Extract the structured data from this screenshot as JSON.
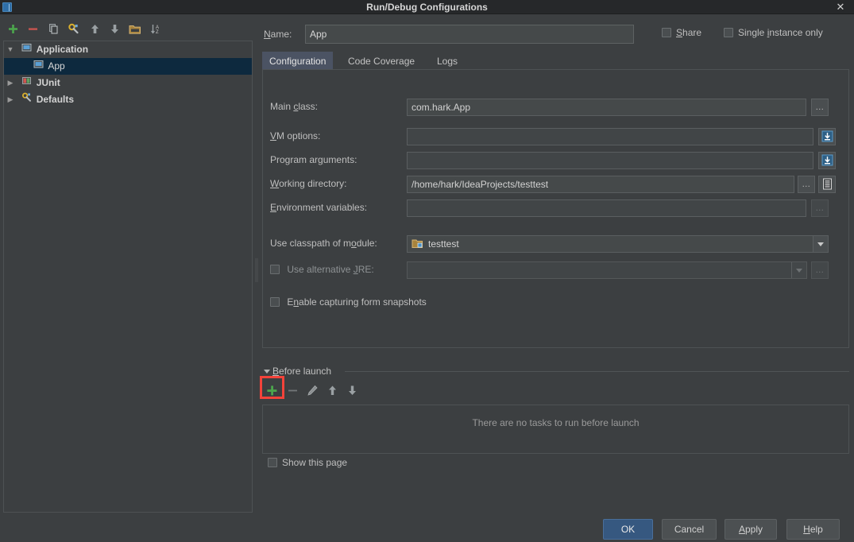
{
  "window": {
    "title": "Run/Debug Configurations",
    "close_label": "✕",
    "icon": "intellij-window-icon"
  },
  "sidebar": {
    "toolbar": [
      {
        "name": "add-configuration-button",
        "icon": "plus-icon",
        "tooltip": "Add New Configuration"
      },
      {
        "name": "remove-configuration-button",
        "icon": "minus-icon",
        "tooltip": "Remove Configuration"
      },
      {
        "name": "copy-configuration-button",
        "icon": "copy-icon",
        "tooltip": "Copy Configuration"
      },
      {
        "name": "edit-defaults-button",
        "icon": "wrench-icon",
        "tooltip": "Edit defaults"
      },
      {
        "name": "move-up-button",
        "icon": "arrow-up-icon",
        "tooltip": "Move Up"
      },
      {
        "name": "move-down-button",
        "icon": "arrow-down-icon",
        "tooltip": "Move Down"
      },
      {
        "name": "create-folder-button",
        "icon": "folder-icon",
        "tooltip": "Create New Folder"
      },
      {
        "name": "sort-configurations-button",
        "icon": "sort-az-icon",
        "tooltip": "Sort Configurations"
      }
    ],
    "tree": [
      {
        "label": "Application",
        "icon": "application-icon",
        "expanded": true,
        "selected": false,
        "level": 0,
        "twisty": "▼"
      },
      {
        "label": "App",
        "icon": "application-icon",
        "expanded": false,
        "selected": true,
        "level": 1,
        "twisty": ""
      },
      {
        "label": "JUnit",
        "icon": "junit-icon",
        "expanded": false,
        "selected": false,
        "level": 0,
        "twisty": "▶"
      },
      {
        "label": "Defaults",
        "icon": "wrench-icon",
        "expanded": false,
        "selected": false,
        "level": 0,
        "twisty": "▶"
      }
    ]
  },
  "header": {
    "name_label": "Name:",
    "name_label_mnemonic": "N",
    "name_value": "App",
    "name_placeholder": "",
    "share": {
      "label": "Share",
      "mnemonic": "S",
      "checked": false
    },
    "single_instance": {
      "label": "Single instance only",
      "mnemonic": "i",
      "checked": false
    }
  },
  "tabs": [
    {
      "label": "Configuration",
      "active": true
    },
    {
      "label": "Code Coverage",
      "active": false
    },
    {
      "label": "Logs",
      "active": false
    }
  ],
  "configuration": {
    "main_class": {
      "label": "Main class:",
      "mnemonic": "c",
      "value": "com.hark.App",
      "browse_icon": "ellipsis-icon"
    },
    "vm_options": {
      "label": "VM options:",
      "mnemonic": "V",
      "value": "",
      "expand_icon": "expand-editor-icon"
    },
    "program_arguments": {
      "label": "Program arguments:",
      "mnemonic": "g",
      "value": "",
      "expand_icon": "expand-editor-icon"
    },
    "working_directory": {
      "label": "Working directory:",
      "mnemonic": "W",
      "value": "/home/hark/IdeaProjects/testtest",
      "browse_icon": "ellipsis-icon",
      "macro_icon": "insert-macro-icon"
    },
    "environment_variables": {
      "label": "Environment variables:",
      "mnemonic": "E",
      "value": "",
      "browse_icon": "ellipsis-icon"
    },
    "use_classpath_of_module": {
      "label": "Use classpath of module:",
      "mnemonic": "o",
      "value": "testtest",
      "icon": "module-icon",
      "arrow_icon": "chevron-down-icon"
    },
    "use_alternative_jre": {
      "label": "Use alternative JRE:",
      "mnemonic": "J",
      "checked": false,
      "value": "",
      "arrow_icon": "chevron-down-icon",
      "browse_icon": "ellipsis-icon"
    },
    "enable_capturing_form_snapshots": {
      "label": "Enable capturing form snapshots",
      "mnemonic": "n",
      "checked": false
    }
  },
  "before_launch": {
    "title": "Before launch",
    "mnemonic": "B",
    "expanded": true,
    "toolbar": [
      {
        "name": "add-task-button",
        "icon": "plus-icon",
        "enabled": true,
        "highlighted": true
      },
      {
        "name": "remove-task-button",
        "icon": "minus-icon",
        "enabled": false,
        "highlighted": false
      },
      {
        "name": "edit-task-button",
        "icon": "pencil-icon",
        "enabled": false,
        "highlighted": false
      },
      {
        "name": "move-task-up-button",
        "icon": "arrow-up-icon",
        "enabled": false,
        "highlighted": false
      },
      {
        "name": "move-task-down-button",
        "icon": "arrow-down-icon",
        "enabled": false,
        "highlighted": false
      }
    ],
    "empty_message": "There are no tasks to run before launch",
    "show_this_page": {
      "label": "Show this page",
      "checked": false
    }
  },
  "footer": {
    "buttons": [
      {
        "label": "OK",
        "primary": true,
        "mnemonic": ""
      },
      {
        "label": "Cancel",
        "primary": false,
        "mnemonic": ""
      },
      {
        "label": "Apply",
        "primary": false,
        "mnemonic": "A"
      },
      {
        "label": "Help",
        "primary": false,
        "mnemonic": "H"
      }
    ]
  },
  "colors": {
    "window_bg": "#3c3f41",
    "titlebar_bg": "#26282a",
    "field_bg": "#45494a",
    "selection_bg": "#0d293e",
    "tab_active_bg": "#4b5363",
    "primary_button_bg": "#365880",
    "highlight_outline": "#f4433a",
    "add_icon_green": "#4ca64c",
    "remove_icon_red": "#c75450"
  }
}
